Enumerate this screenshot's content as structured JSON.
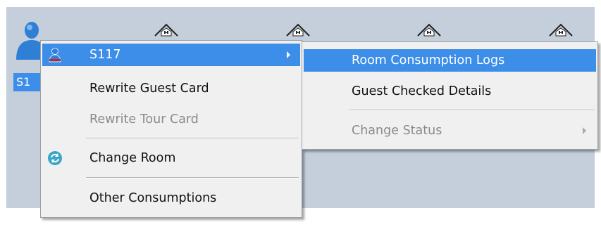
{
  "rooms": {
    "icon": "house-icon"
  },
  "guest": {
    "icon": "person-icon",
    "label": "S1"
  },
  "context_menu": {
    "items": [
      {
        "label": "S117",
        "icon": "person-icon",
        "has_submenu": true,
        "highlighted": true,
        "enabled": true
      },
      {
        "label": "Rewrite Guest Card",
        "enabled": true
      },
      {
        "label": "Rewrite Tour Card",
        "enabled": false
      },
      {
        "label": "Change Room",
        "icon": "refresh-icon",
        "enabled": true
      },
      {
        "label": "Other Consumptions",
        "enabled": true
      }
    ]
  },
  "submenu": {
    "items": [
      {
        "label": "Room Consumption Logs",
        "highlighted": true,
        "enabled": true
      },
      {
        "label": "Guest Checked Details",
        "enabled": true
      },
      {
        "label": "Change Status",
        "has_submenu": true,
        "enabled": false
      }
    ]
  },
  "colors": {
    "panel_bg": "#c4cfdb",
    "menu_bg": "#f0f0f0",
    "highlight": "#3d8ee8",
    "disabled_text": "#8a8a8a"
  }
}
